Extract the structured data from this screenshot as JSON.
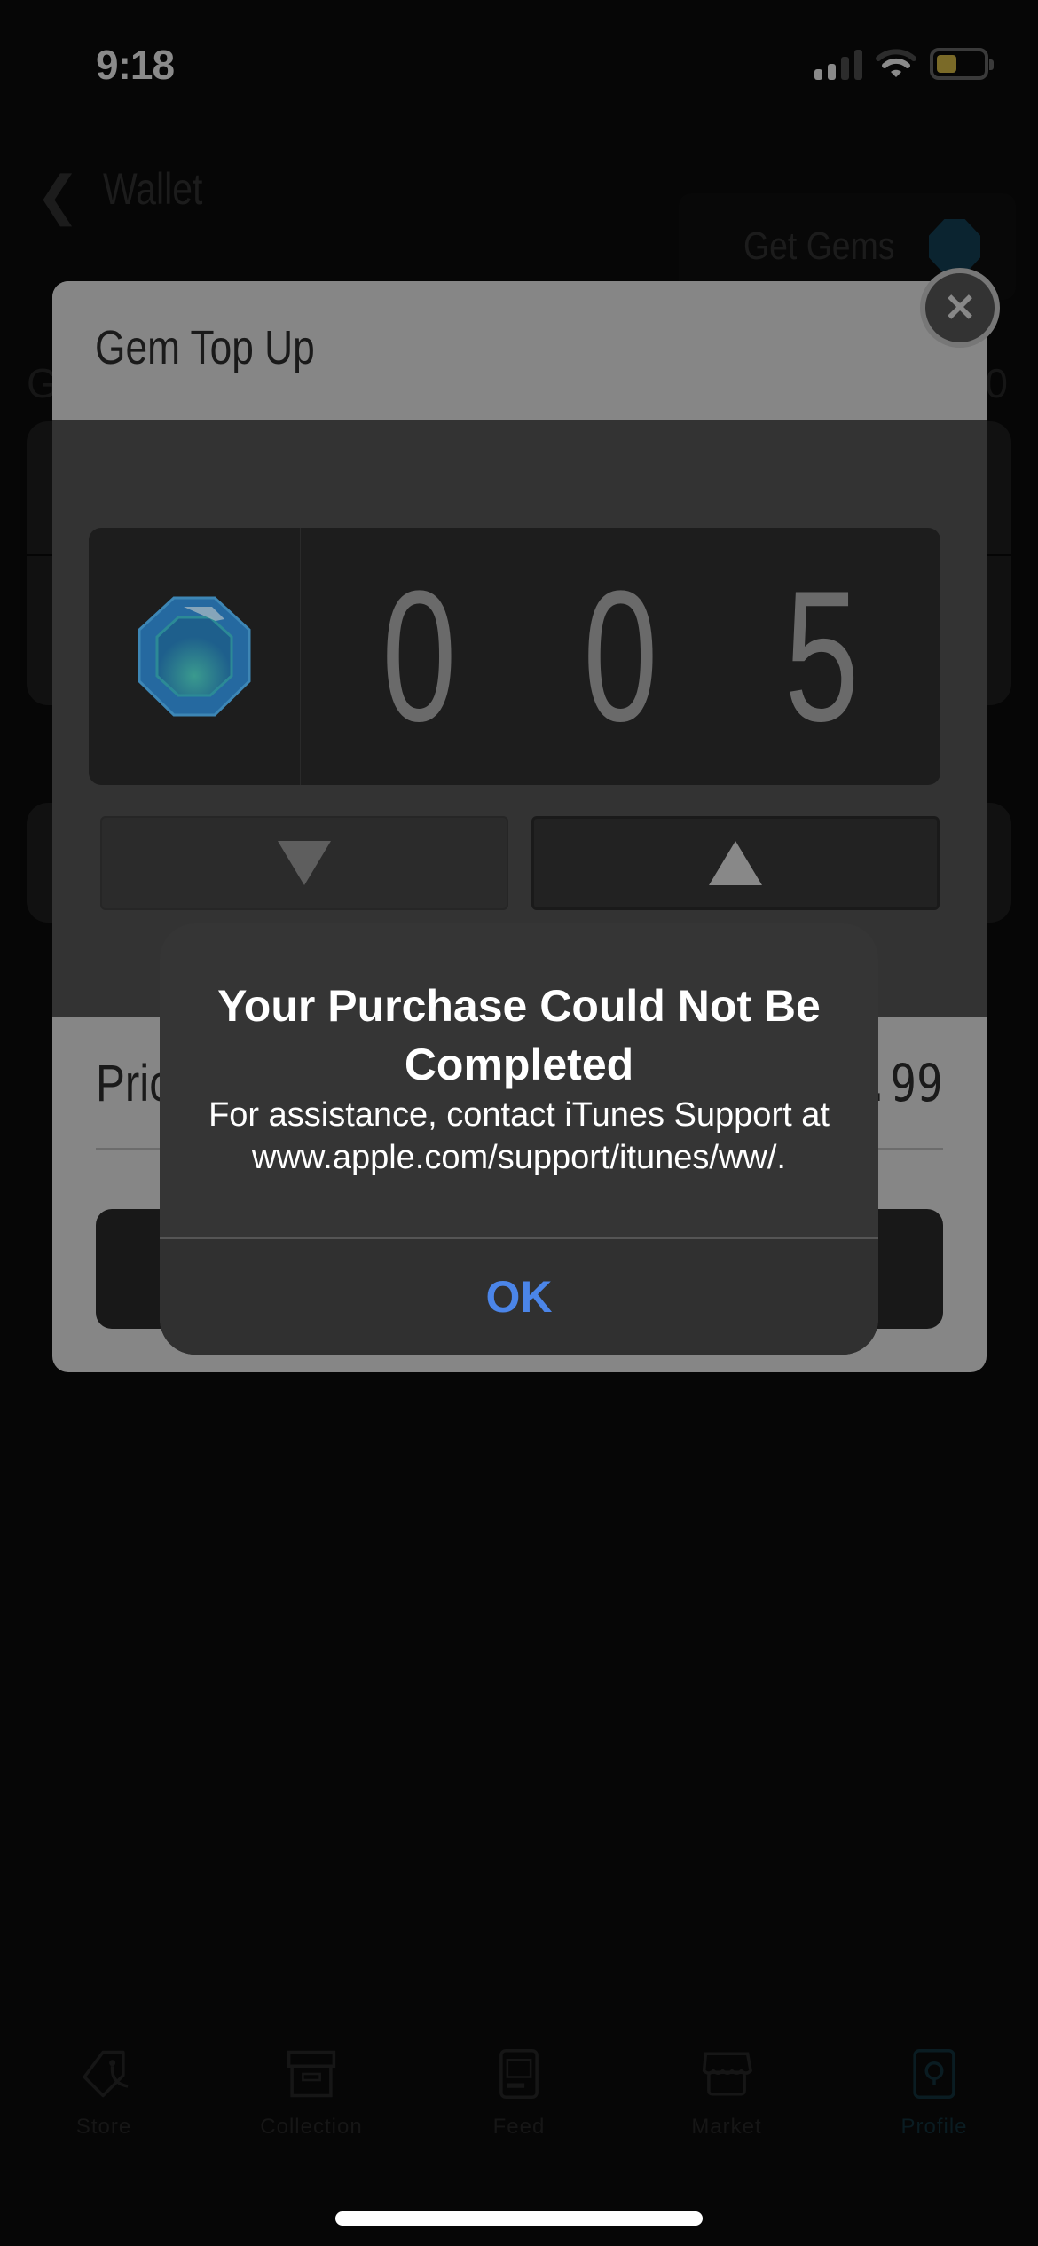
{
  "status_bar": {
    "time": "9:18",
    "signal_icon": "cellular-signal-icon",
    "wifi_icon": "wifi-icon",
    "battery_icon": "battery-low-power-icon",
    "battery_color": "#7a6a28"
  },
  "background_page": {
    "nav_back_icon": "chevron-left-icon",
    "title": "Wallet",
    "get_gems_label": "Get Gems",
    "left_label_partial": "G",
    "right_value_partial": "00"
  },
  "gem_top_up": {
    "title": "Gem Top Up",
    "close_icon": "close-icon",
    "gem_icon": "gem-icon",
    "quantity_digits": [
      "0",
      "0",
      "5"
    ],
    "decrement_icon": "triangle-down-icon",
    "increment_icon": "triangle-up-icon",
    "price_label_partial": "Pric",
    "price_value_partial": ".99"
  },
  "alert": {
    "title": "Your Purchase Could Not Be Completed",
    "message": "For assistance, contact iTunes Support at www.apple.com/support/itunes/ww/.",
    "ok_label": "OK",
    "ok_color": "#4b85e8"
  },
  "tab_bar": {
    "items": [
      {
        "label": "Store",
        "icon": "price-tag-icon"
      },
      {
        "label": "Collection",
        "icon": "archive-box-icon"
      },
      {
        "label": "Feed",
        "icon": "feed-card-icon"
      },
      {
        "label": "Market",
        "icon": "storefront-icon"
      },
      {
        "label": "Profile",
        "icon": "profile-icon",
        "active": true
      }
    ]
  }
}
